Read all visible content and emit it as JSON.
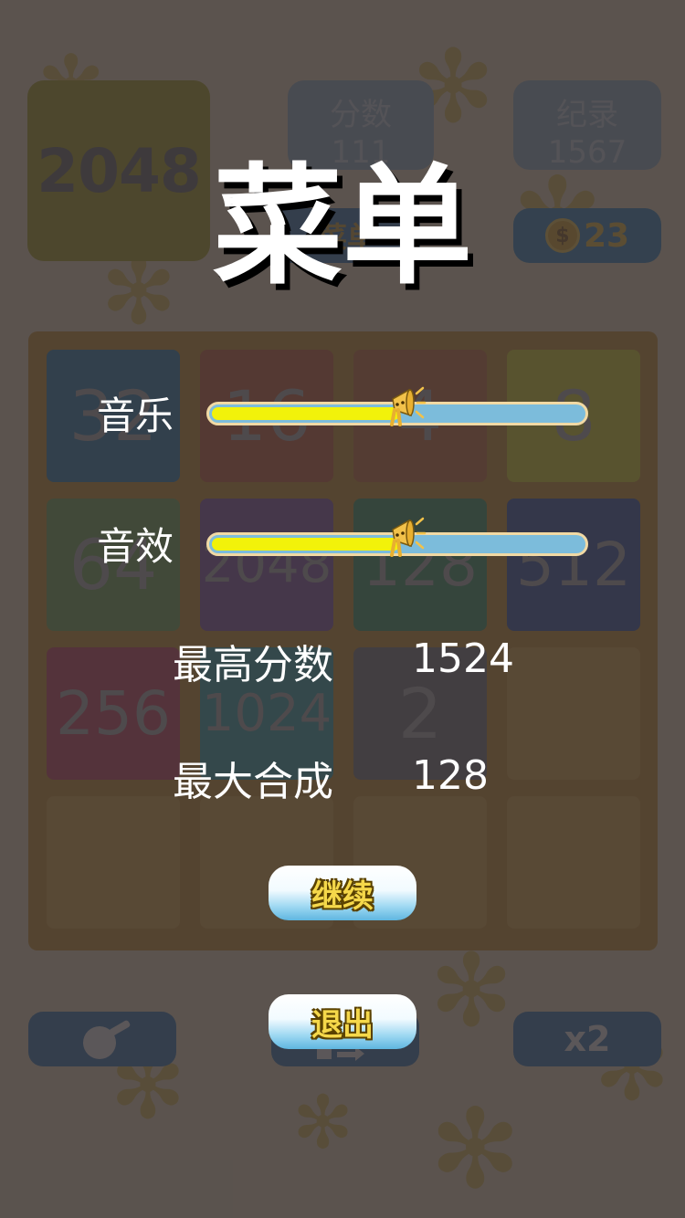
{
  "background_game": {
    "logo_text": "2048",
    "score_box": {
      "label": "分数",
      "value": "111"
    },
    "record_box": {
      "label": "纪录",
      "value": "1567"
    },
    "coins": {
      "symbol": "$",
      "count": "23"
    },
    "menu_button_label": "菜单",
    "tiles": [
      {
        "text": "32",
        "color": "#1f78a8"
      },
      {
        "text": "16",
        "color": "#c9542d"
      },
      {
        "text": "4",
        "color": "#c9642d"
      },
      {
        "text": "8",
        "color": "#dcd61a"
      },
      {
        "text": "64",
        "color": "#6aa74a"
      },
      {
        "text": "2048",
        "color": "#7d4b9e"
      },
      {
        "text": "128",
        "color": "#2e8f5a"
      },
      {
        "text": "512",
        "color": "#2a4ea0"
      },
      {
        "text": "256",
        "color": "#c63b55"
      },
      {
        "text": "1024",
        "color": "#2a9ea6"
      },
      {
        "text": "2",
        "color": "#6e6e72"
      },
      {
        "text": "",
        "color": "#dca33a"
      },
      {
        "text": "",
        "color": "#dca33a"
      },
      {
        "text": "",
        "color": "#dca33a"
      },
      {
        "text": "",
        "color": "#dca33a"
      },
      {
        "text": "",
        "color": "#dca33a"
      }
    ],
    "bottom_icons": [
      "bomb-icon",
      "swap-icon",
      "double-icon"
    ],
    "double_label": "x2"
  },
  "menu": {
    "title": "菜单",
    "music": {
      "label": "音乐",
      "level": 0.5
    },
    "sound_effects": {
      "label": "音效",
      "level": 0.5
    },
    "high_score": {
      "label": "最高分数",
      "value": "1524"
    },
    "max_tile": {
      "label": "最大合成",
      "value": "128"
    },
    "continue_label": "继续",
    "exit_label": "退出"
  },
  "colors": {
    "overlay": "#373234",
    "slider_fill": "#f2f20a",
    "slider_track": "#7cbcdb",
    "button_text": "#f5d84a"
  }
}
